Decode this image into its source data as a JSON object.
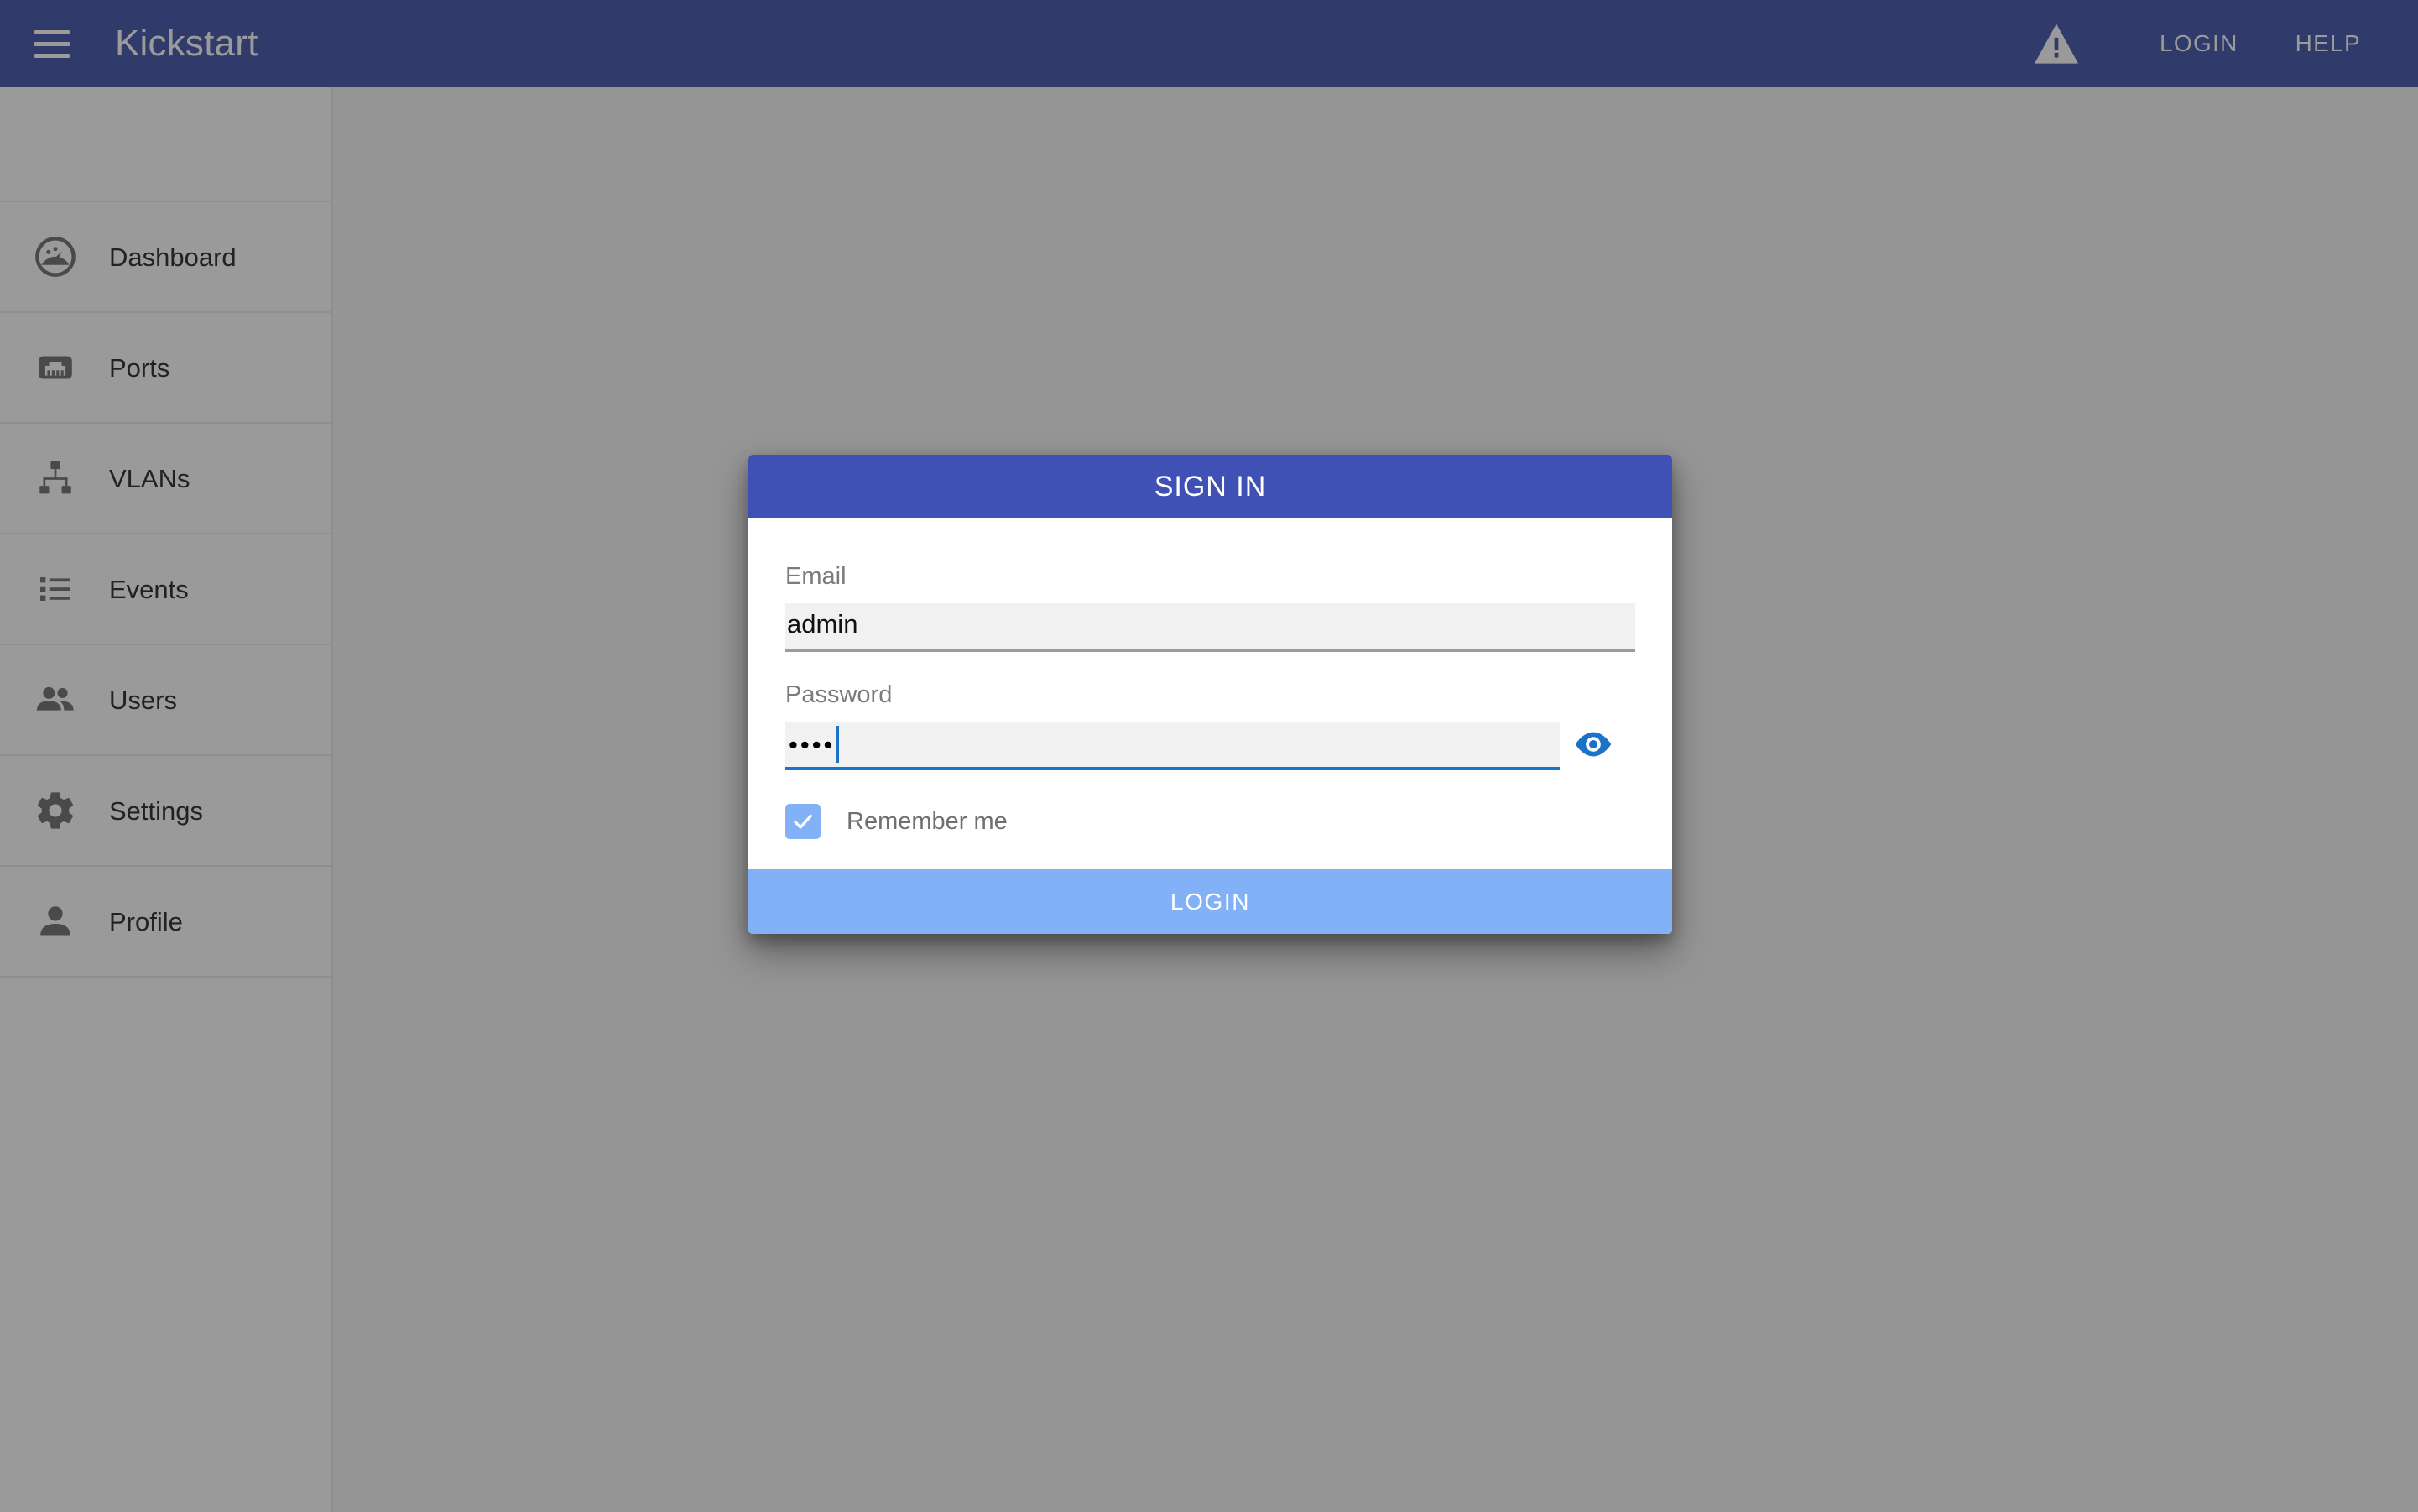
{
  "header": {
    "menu_icon": "hamburger-menu-icon",
    "title": "Kickstart",
    "warning_icon": "warning-triangle-icon",
    "login_label": "LOGIN",
    "help_label": "HELP"
  },
  "sidebar": {
    "items": [
      {
        "label": "Dashboard",
        "icon": "speedometer-icon"
      },
      {
        "label": "Ports",
        "icon": "ethernet-port-icon"
      },
      {
        "label": "VLANs",
        "icon": "network-tree-icon"
      },
      {
        "label": "Events",
        "icon": "list-bullet-icon"
      },
      {
        "label": "Users",
        "icon": "people-icon"
      },
      {
        "label": "Settings",
        "icon": "gear-icon"
      },
      {
        "label": "Profile",
        "icon": "person-icon"
      }
    ]
  },
  "dialog": {
    "title": "SIGN IN",
    "email": {
      "label": "Email",
      "value": "admin",
      "placeholder": ""
    },
    "password": {
      "label": "Password",
      "value": "••••",
      "masked_char_count": 4,
      "placeholder": "",
      "toggle_icon": "eye-icon",
      "focused": true
    },
    "remember": {
      "label": "Remember me",
      "checked": true,
      "check_icon": "checkmark-icon"
    },
    "submit_label": "LOGIN"
  },
  "colors": {
    "app_bar": "#303a6b",
    "dialog_header": "#3f51b5",
    "submit_button": "#82b1f7",
    "accent_focus": "#1a73c8",
    "scrim": "#959595",
    "sidebar": "#9a9a9a"
  }
}
